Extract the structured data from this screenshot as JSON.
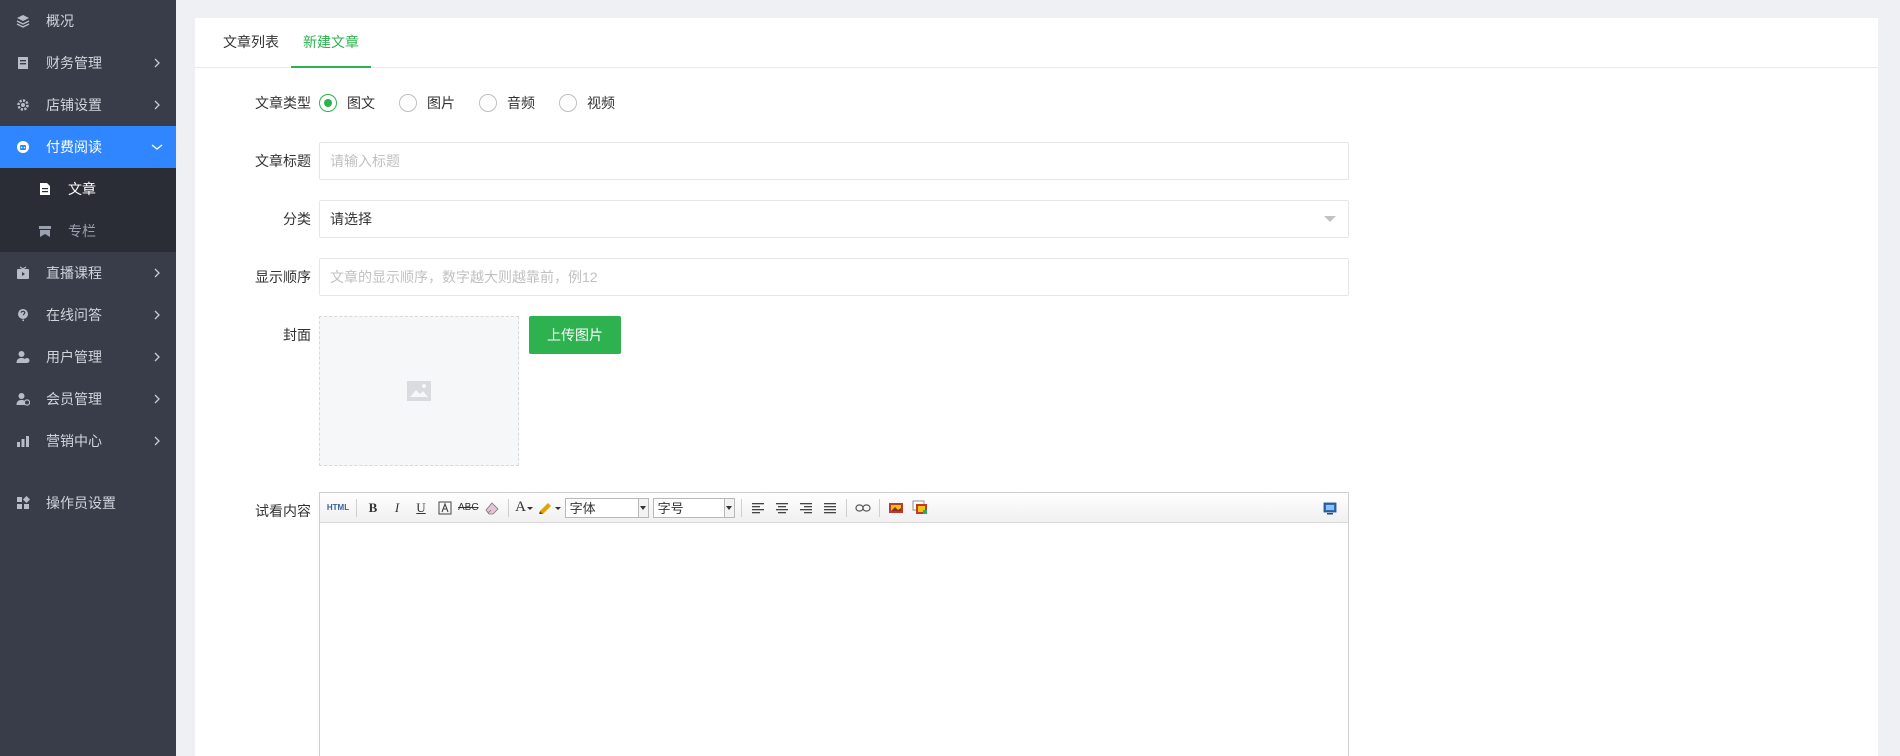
{
  "sidebar": {
    "items": [
      {
        "label": "概况",
        "icon": "layers-icon"
      },
      {
        "label": "财务管理",
        "icon": "ledger-icon"
      },
      {
        "label": "店铺设置",
        "icon": "gear-icon"
      },
      {
        "label": "付费阅读",
        "icon": "paid-reading-icon"
      },
      {
        "label": "直播课程",
        "icon": "video-camera-icon"
      },
      {
        "label": "在线问答",
        "icon": "question-icon"
      },
      {
        "label": "用户管理",
        "icon": "user-manage-icon"
      },
      {
        "label": "会员管理",
        "icon": "member-icon"
      },
      {
        "label": "营销中心",
        "icon": "marketing-icon"
      }
    ],
    "submenu": [
      {
        "label": "文章",
        "icon": "document-icon"
      },
      {
        "label": "专栏",
        "icon": "column-icon"
      }
    ],
    "operator": {
      "label": "操作员设置",
      "icon": "operator-settings-icon"
    }
  },
  "tabs": [
    {
      "label": "文章列表"
    },
    {
      "label": "新建文章"
    }
  ],
  "form": {
    "type_label": "文章类型",
    "type_options": [
      "图文",
      "图片",
      "音频",
      "视频"
    ],
    "title_label": "文章标题",
    "title_placeholder": "请输入标题",
    "category_label": "分类",
    "category_value": "请选择",
    "order_label": "显示顺序",
    "order_placeholder": "文章的显示顺序，数字越大则越靠前，例12",
    "cover_label": "封面",
    "upload_button": "上传图片",
    "preview_label": "试看内容"
  },
  "editor": {
    "html_label": "HTML",
    "bold": "B",
    "italic": "I",
    "underline": "U",
    "strike": "ABC",
    "font_color": "A",
    "font_family": "字体",
    "font_size": "字号"
  },
  "colors": {
    "accent": "#2eb24f",
    "sidebar_bg": "#393d49",
    "sidebar_active": "#2f86ff"
  }
}
